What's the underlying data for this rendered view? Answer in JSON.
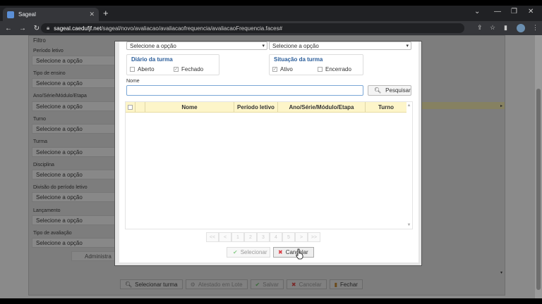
{
  "browser": {
    "tab_title": "Sageal",
    "tab_close": "✕",
    "new_tab": "+",
    "url_host": "sageal.caedufjf.net",
    "url_path": "/sageal/novo/avaliacao/avaliacaofrequencia/avaliacaoFrequencia.faces#"
  },
  "filters": {
    "title": "Filtro",
    "fields": [
      {
        "label": "Período letivo",
        "value": "Selecione a opção"
      },
      {
        "label": "Tipo de ensino",
        "value": "Selecione a opção"
      },
      {
        "label": "Ano/Série/Módulo/Etapa",
        "value": "Selecione a opção"
      },
      {
        "label": "Turno",
        "value": "Selecione a opção"
      },
      {
        "label": "Turma",
        "value": "Selecione a opção"
      },
      {
        "label": "Disciplina",
        "value": "Selecione a opção"
      },
      {
        "label": "Divisão do período letivo",
        "value": "Selecione a opção"
      },
      {
        "label": "Lançamento",
        "value": "Selecione a opção"
      },
      {
        "label": "Tipo de avaliação",
        "value": "Selecione a opção"
      }
    ],
    "admin_button": "Administra"
  },
  "toolbar": {
    "select_class": "Selecionar turma",
    "atestado": "Atestado em Lote",
    "save": "Salvar",
    "cancel": "Cancelar",
    "close": "Fechar"
  },
  "modal": {
    "select_left": "Selecione a opção",
    "select_right": "Selecione a opção",
    "diario": {
      "title": "Diário da turma",
      "options": [
        {
          "label": "Aberto",
          "checked": false
        },
        {
          "label": "Fechado",
          "checked": true
        }
      ]
    },
    "situacao": {
      "title": "Situação da turma",
      "options": [
        {
          "label": "Ativo",
          "checked": true
        },
        {
          "label": "Encerrado",
          "checked": false
        }
      ]
    },
    "name_label": "Nome",
    "name_value": "",
    "search_button": "Pesquisar",
    "columns": [
      "Nome",
      "Período letivo",
      "Ano/Série/Módulo/Etapa",
      "Turno"
    ],
    "pager": [
      "<<",
      "<",
      "1",
      "2",
      "3",
      "4",
      "5",
      ">",
      ">>"
    ],
    "select_button": "Selecionar",
    "cancel_button": "Cancelar"
  },
  "colors": {
    "accent_blue": "#2a5d9a",
    "header_yellow": "#fdf5c9",
    "cancel_red": "#d9363e",
    "ok_green": "#3aa845"
  }
}
